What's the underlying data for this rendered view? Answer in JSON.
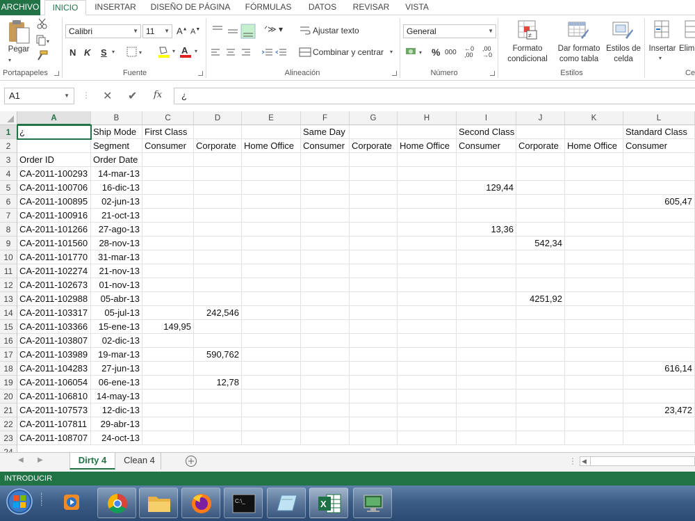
{
  "ribbon_tabs": [
    "ARCHIVO",
    "INICIO",
    "INSERTAR",
    "DISEÑO DE PÁGINA",
    "FÓRMULAS",
    "DATOS",
    "REVISAR",
    "VISTA"
  ],
  "ribbon": {
    "paste_label": "Pegar",
    "font_name": "Calibri",
    "font_size": "11",
    "bold": "N",
    "italic": "K",
    "underline": "S",
    "wrap_text": "Ajustar texto",
    "merge_center": "Combinar y centrar",
    "number_format": "General",
    "percent": "%",
    "thousands": "000",
    "cond_format": "Formato\ncondicional",
    "format_table": "Dar formato\ncomo tabla",
    "cell_styles": "Estilos de\ncelda",
    "insert": "Insertar",
    "delete": "Elim",
    "groups": [
      "Portapapeles",
      "Fuente",
      "Alineación",
      "Número",
      "Estilos",
      "Ce"
    ]
  },
  "formula_bar": {
    "name_box": "A1",
    "fx": "fx",
    "content": "¿"
  },
  "columns": [
    "A",
    "B",
    "C",
    "D",
    "E",
    "F",
    "G",
    "H",
    "I",
    "J",
    "K",
    "L"
  ],
  "rows": [
    {
      "n": "1",
      "cells": [
        "¿",
        "Ship Mode",
        "First Class",
        "",
        "",
        "Same Day",
        "",
        "",
        "Second Class",
        "",
        "",
        "Standard Class"
      ]
    },
    {
      "n": "2",
      "cells": [
        "",
        "Segment",
        "Consumer",
        "Corporate",
        "Home Office",
        "Consumer",
        "Corporate",
        "Home Office",
        "Consumer",
        "Corporate",
        "Home Office",
        "Consumer"
      ]
    },
    {
      "n": "3",
      "cells": [
        "Order ID",
        "Order Date",
        "",
        "",
        "",
        "",
        "",
        "",
        "",
        "",
        "",
        ""
      ]
    },
    {
      "n": "4",
      "cells": [
        "CA-2011-100293",
        "14-mar-13",
        "",
        "",
        "",
        "",
        "",
        "",
        "",
        "",
        "",
        ""
      ]
    },
    {
      "n": "5",
      "cells": [
        "CA-2011-100706",
        "16-dic-13",
        "",
        "",
        "",
        "",
        "",
        "",
        "129,44",
        "",
        "",
        ""
      ]
    },
    {
      "n": "6",
      "cells": [
        "CA-2011-100895",
        "02-jun-13",
        "",
        "",
        "",
        "",
        "",
        "",
        "",
        "",
        "",
        "605,47"
      ]
    },
    {
      "n": "7",
      "cells": [
        "CA-2011-100916",
        "21-oct-13",
        "",
        "",
        "",
        "",
        "",
        "",
        "",
        "",
        "",
        ""
      ]
    },
    {
      "n": "8",
      "cells": [
        "CA-2011-101266",
        "27-ago-13",
        "",
        "",
        "",
        "",
        "",
        "",
        "13,36",
        "",
        "",
        ""
      ]
    },
    {
      "n": "9",
      "cells": [
        "CA-2011-101560",
        "28-nov-13",
        "",
        "",
        "",
        "",
        "",
        "",
        "",
        "542,34",
        "",
        ""
      ]
    },
    {
      "n": "10",
      "cells": [
        "CA-2011-101770",
        "31-mar-13",
        "",
        "",
        "",
        "",
        "",
        "",
        "",
        "",
        "",
        ""
      ]
    },
    {
      "n": "11",
      "cells": [
        "CA-2011-102274",
        "21-nov-13",
        "",
        "",
        "",
        "",
        "",
        "",
        "",
        "",
        "",
        ""
      ]
    },
    {
      "n": "12",
      "cells": [
        "CA-2011-102673",
        "01-nov-13",
        "",
        "",
        "",
        "",
        "",
        "",
        "",
        "",
        "",
        ""
      ]
    },
    {
      "n": "13",
      "cells": [
        "CA-2011-102988",
        "05-abr-13",
        "",
        "",
        "",
        "",
        "",
        "",
        "",
        "4251,92",
        "",
        ""
      ]
    },
    {
      "n": "14",
      "cells": [
        "CA-2011-103317",
        "05-jul-13",
        "",
        "242,546",
        "",
        "",
        "",
        "",
        "",
        "",
        "",
        ""
      ]
    },
    {
      "n": "15",
      "cells": [
        "CA-2011-103366",
        "15-ene-13",
        "149,95",
        "",
        "",
        "",
        "",
        "",
        "",
        "",
        "",
        ""
      ]
    },
    {
      "n": "16",
      "cells": [
        "CA-2011-103807",
        "02-dic-13",
        "",
        "",
        "",
        "",
        "",
        "",
        "",
        "",
        "",
        ""
      ]
    },
    {
      "n": "17",
      "cells": [
        "CA-2011-103989",
        "19-mar-13",
        "",
        "590,762",
        "",
        "",
        "",
        "",
        "",
        "",
        "",
        ""
      ]
    },
    {
      "n": "18",
      "cells": [
        "CA-2011-104283",
        "27-jun-13",
        "",
        "",
        "",
        "",
        "",
        "",
        "",
        "",
        "",
        "616,14"
      ]
    },
    {
      "n": "19",
      "cells": [
        "CA-2011-106054",
        "06-ene-13",
        "",
        "12,78",
        "",
        "",
        "",
        "",
        "",
        "",
        "",
        ""
      ]
    },
    {
      "n": "20",
      "cells": [
        "CA-2011-106810",
        "14-may-13",
        "",
        "",
        "",
        "",
        "",
        "",
        "",
        "",
        "",
        ""
      ]
    },
    {
      "n": "21",
      "cells": [
        "CA-2011-107573",
        "12-dic-13",
        "",
        "",
        "",
        "",
        "",
        "",
        "",
        "",
        "",
        "23,472"
      ]
    },
    {
      "n": "22",
      "cells": [
        "CA-2011-107811",
        "29-abr-13",
        "",
        "",
        "",
        "",
        "",
        "",
        "",
        "",
        "",
        ""
      ]
    },
    {
      "n": "23",
      "cells": [
        "CA-2011-108707",
        "24-oct-13",
        "",
        "",
        "",
        "",
        "",
        "",
        "",
        "",
        "",
        ""
      ]
    }
  ],
  "sheet_tabs": [
    "Dirty 4",
    "Clean 4"
  ],
  "status": "INTRODUCIR",
  "taskbar_apps": [
    "start-orb",
    "media-player",
    "chrome",
    "file-explorer",
    "firefox",
    "command-prompt",
    "notepad",
    "excel",
    "remote-desktop"
  ]
}
